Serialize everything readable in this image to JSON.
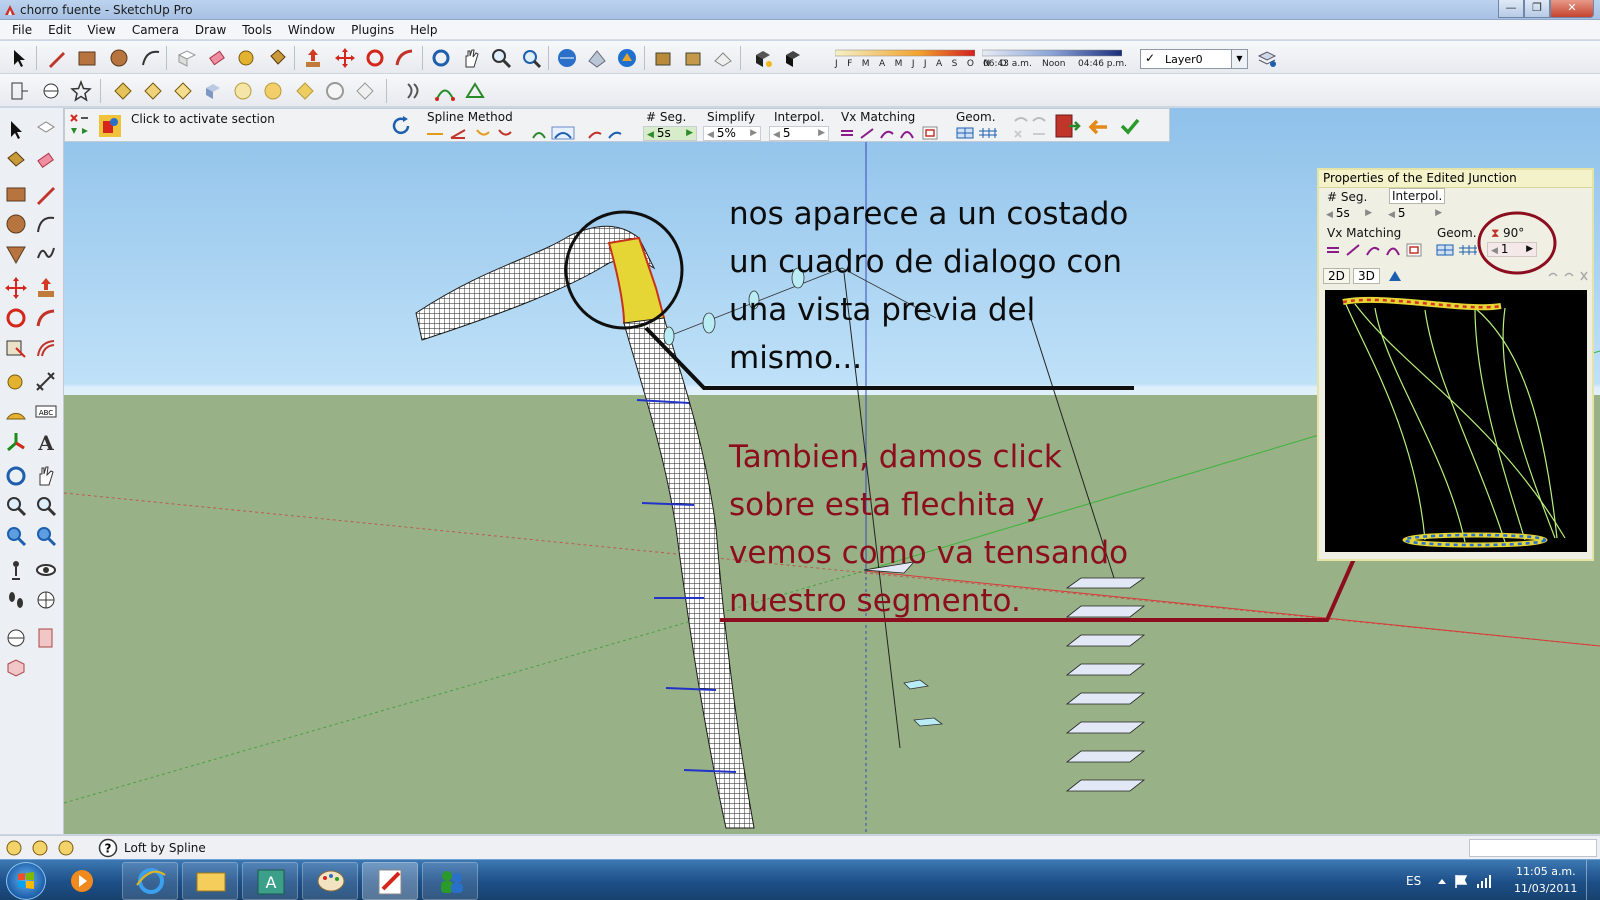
{
  "window": {
    "title": "chorro fuente - SketchUp Pro",
    "buttons": {
      "minimize": "—",
      "maximize": "❐",
      "close": "✕"
    }
  },
  "menu": [
    "File",
    "Edit",
    "View",
    "Camera",
    "Draw",
    "Tools",
    "Window",
    "Plugins",
    "Help"
  ],
  "shadows": {
    "months": "J F M A M J J A S O N D",
    "time_start": "06:43 a.m.",
    "time_mid": "Noon",
    "time_end": "04:46 p.m."
  },
  "layer": {
    "checked": "✓",
    "name": "Layer0"
  },
  "loft_toolbar": {
    "hint": "Click to activate section",
    "spline_method_label": "Spline Method",
    "seg_label": "# Seg.",
    "seg_value": "5s",
    "simplify_label": "Simplify",
    "simplify_value": "5%",
    "interpol_label": "Interpol.",
    "interpol_value": "5",
    "vx_matching_label": "Vx Matching",
    "geom_label": "Geom."
  },
  "annotations": {
    "black_note": [
      "nos aparece a un costado",
      "un cuadro de dialogo con",
      "una vista previa del",
      "mismo..."
    ],
    "red_note": [
      "Tambien, damos click",
      "sobre esta flechita y",
      "vemos como va tensando",
      "nuestro segmento."
    ]
  },
  "properties_panel": {
    "title": "Properties of the Edited Junction",
    "seg_label": "# Seg.",
    "seg_value": "5s",
    "interpol_label": "Interpol.",
    "interpol_value": "5",
    "vx_matching_label": "Vx Matching",
    "geom_label": "Geom.",
    "angle_value": "90°",
    "tension_value": "1",
    "tab_2d": "2D",
    "tab_3d": "3D"
  },
  "status": {
    "text": "Loft by Spline"
  },
  "taskbar": {
    "language": "ES",
    "time": "11:05 a.m.",
    "date": "11/03/2011"
  },
  "colors": {
    "annotation_red": "#8c0d1d",
    "sky": "#bfe1f8",
    "ground": "#98b186"
  }
}
